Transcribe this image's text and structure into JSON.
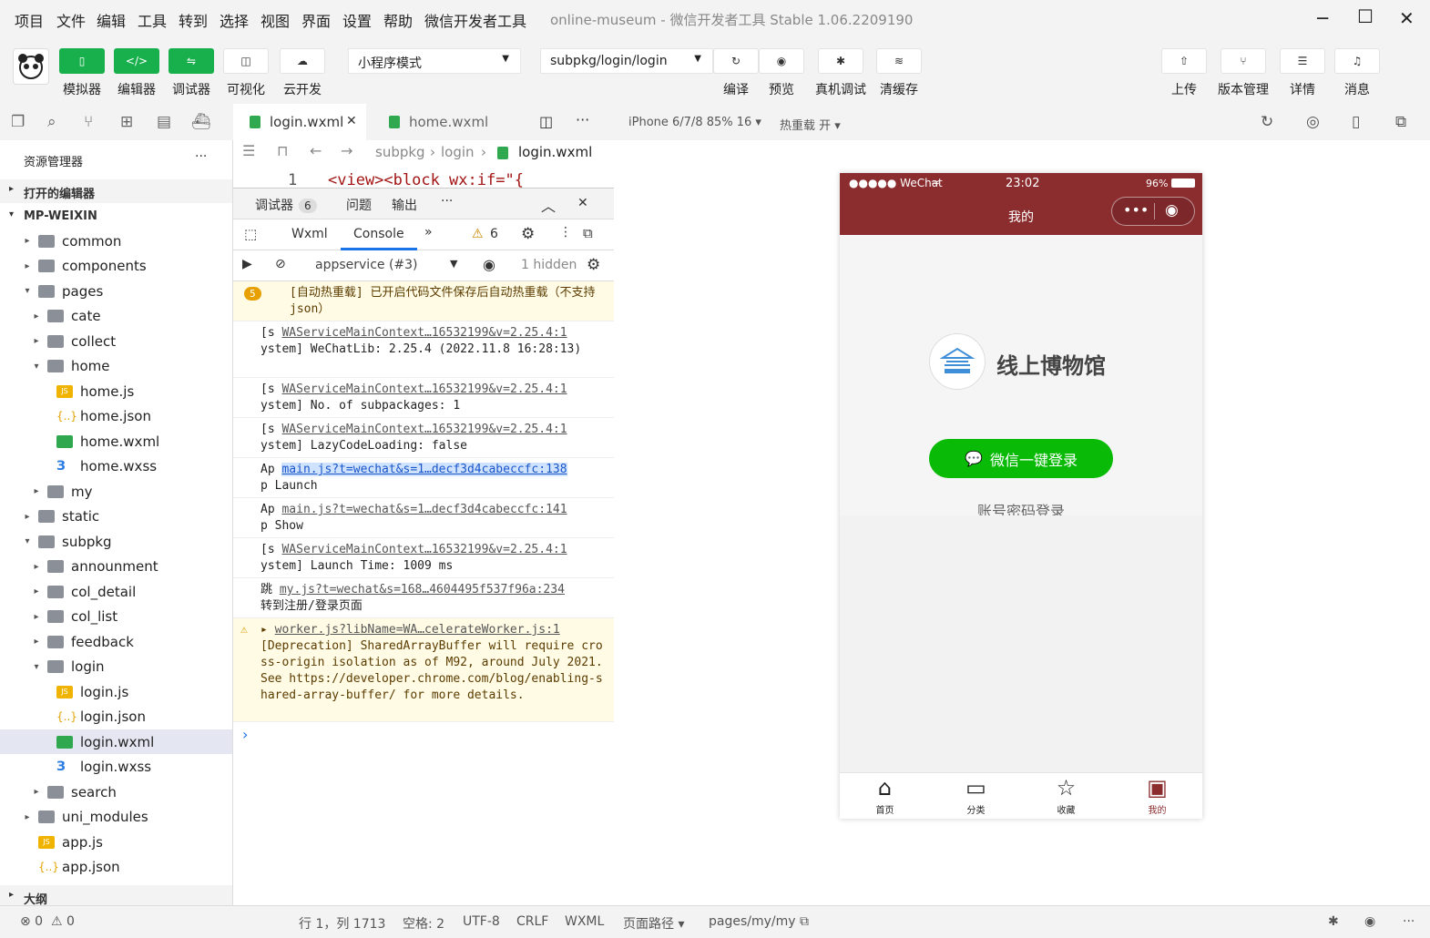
{
  "menu": [
    "项目",
    "文件",
    "编辑",
    "工具",
    "转到",
    "选择",
    "视图",
    "界面",
    "设置",
    "帮助",
    "微信开发者工具"
  ],
  "window_title": {
    "project": "online-museum",
    "separator": "-",
    "app": "微信开发者工具 Stable 1.06.2209190"
  },
  "toolbar": {
    "buttons_left": [
      "模拟器",
      "编辑器",
      "调试器",
      "可视化",
      "云开发"
    ],
    "mode_select": "小程序模式",
    "page_select": "subpkg/login/login",
    "buttons_mid": [
      "编译",
      "预览",
      "真机调试",
      "清缓存"
    ],
    "buttons_right": [
      "上传",
      "版本管理",
      "详情",
      "消息"
    ]
  },
  "explorer": {
    "title": "资源管理器",
    "more": "···",
    "open_editors": "打开的编辑器",
    "root": "MP-WEIXIN",
    "items": [
      {
        "label": "common",
        "type": "folder",
        "arrow": "▸",
        "depth": 1
      },
      {
        "label": "components",
        "type": "folder",
        "arrow": "▸",
        "depth": 1
      },
      {
        "label": "pages",
        "type": "folder",
        "arrow": "▾",
        "depth": 1
      },
      {
        "label": "cate",
        "type": "folder",
        "arrow": "▸",
        "depth": 2
      },
      {
        "label": "collect",
        "type": "folder",
        "arrow": "▸",
        "depth": 2
      },
      {
        "label": "home",
        "type": "folder",
        "arrow": "▾",
        "depth": 2
      },
      {
        "label": "home.js",
        "type": "js",
        "arrow": "",
        "depth": 3
      },
      {
        "label": "home.json",
        "type": "json",
        "arrow": "",
        "depth": 3
      },
      {
        "label": "home.wxml",
        "type": "wxml",
        "arrow": "",
        "depth": 3
      },
      {
        "label": "home.wxss",
        "type": "wxss",
        "arrow": "",
        "depth": 3
      },
      {
        "label": "my",
        "type": "folder",
        "arrow": "▸",
        "depth": 2
      },
      {
        "label": "static",
        "type": "folder",
        "arrow": "▸",
        "depth": 1
      },
      {
        "label": "subpkg",
        "type": "folder",
        "arrow": "▾",
        "depth": 1
      },
      {
        "label": "announment",
        "type": "folder",
        "arrow": "▸",
        "depth": 2
      },
      {
        "label": "col_detail",
        "type": "folder",
        "arrow": "▸",
        "depth": 2
      },
      {
        "label": "col_list",
        "type": "folder",
        "arrow": "▸",
        "depth": 2
      },
      {
        "label": "feedback",
        "type": "folder",
        "arrow": "▸",
        "depth": 2
      },
      {
        "label": "login",
        "type": "folder",
        "arrow": "▾",
        "depth": 2
      },
      {
        "label": "login.js",
        "type": "js",
        "arrow": "",
        "depth": 3
      },
      {
        "label": "login.json",
        "type": "json",
        "arrow": "",
        "depth": 3
      },
      {
        "label": "login.wxml",
        "type": "wxml",
        "arrow": "",
        "depth": 3,
        "active": true
      },
      {
        "label": "login.wxss",
        "type": "wxss",
        "arrow": "",
        "depth": 3
      },
      {
        "label": "search",
        "type": "folder",
        "arrow": "▸",
        "depth": 2
      },
      {
        "label": "uni_modules",
        "type": "folder",
        "arrow": "▸",
        "depth": 1
      },
      {
        "label": "app.js",
        "type": "js",
        "arrow": "",
        "depth": 1
      },
      {
        "label": "app.json",
        "type": "json",
        "arrow": "",
        "depth": 1
      }
    ],
    "outline": "大纲"
  },
  "editor": {
    "tabs": [
      "login.wxml",
      "home.wxml"
    ],
    "breadcrumb": [
      "subpkg",
      "login",
      "login.wxml"
    ],
    "code_line_no": "1",
    "code_line": "<view><block wx:if=\"{"
  },
  "devtools": {
    "tabs": [
      "调试器",
      "问题",
      "输出",
      "···"
    ],
    "debugger_badge": "6",
    "subtabs": [
      "Wxml",
      "Console",
      "»"
    ],
    "warn_count": "6",
    "context": "appservice (#3)",
    "hidden": "1 hidden",
    "logs": [
      {
        "kind": "warn",
        "badge": "5",
        "text": "[自动热重载] 已开启代码文件保存后自动热重载（不支持 json）"
      },
      {
        "kind": "info",
        "prefix": "[s",
        "link": "WAServiceMainContext…16532199&v=2.25.4:1",
        "text": "ystem] WeChatLib: 2.25.4 (2022.11.8 16:28:13)"
      },
      {
        "kind": "info",
        "prefix": "[s",
        "link": "WAServiceMainContext…16532199&v=2.25.4:1",
        "text": "ystem] No. of subpackages: 1"
      },
      {
        "kind": "info",
        "prefix": "[s",
        "link": "WAServiceMainContext…16532199&v=2.25.4:1",
        "text": "ystem] LazyCodeLoading: false"
      },
      {
        "kind": "info",
        "prefix": "Ap",
        "link": "main.js?t=wechat&s=1…decf3d4cabeccfc:138",
        "text": "p Launch",
        "hl": true
      },
      {
        "kind": "info",
        "prefix": "Ap",
        "link": "main.js?t=wechat&s=1…decf3d4cabeccfc:141",
        "text": "p Show"
      },
      {
        "kind": "info",
        "prefix": "[s",
        "link": "WAServiceMainContext…16532199&v=2.25.4:1",
        "text": "ystem] Launch Time: 1009 ms"
      },
      {
        "kind": "info",
        "prefix": "跳",
        "link": "my.js?t=wechat&s=168…4604495f537f96a:234",
        "text": "转到注册/登录页面"
      },
      {
        "kind": "warnbox",
        "prefix": "▸",
        "link": "worker.js?libName=WA…celerateWorker.js:1",
        "text": "[Deprecation] SharedArrayBuffer will require cross-origin isolation as of M92, around July 2021. See https://developer.chrome.com/blog/enabling-shared-array-buffer/ for more details."
      }
    ],
    "prompt": "›"
  },
  "simulator": {
    "device": "iPhone 6/7/8 85% 16 ▾",
    "hot_reload": "热重载 开 ▾",
    "status_left": "●●●●● WeChat",
    "status_time": "23:02",
    "status_battery": "96%",
    "nav_title": "我的",
    "brand_text": "线上博物馆",
    "login_button": "微信一键登录",
    "password_login": "账号密码登录",
    "tabbar": [
      {
        "label": "首页",
        "icon": "home-icon",
        "active": false
      },
      {
        "label": "分类",
        "icon": "folder-icon",
        "active": false
      },
      {
        "label": "收藏",
        "icon": "star-icon",
        "active": false
      },
      {
        "label": "我的",
        "icon": "profile-icon",
        "active": true
      }
    ],
    "accent_color": "#8b2d2f",
    "button_color": "#09bb07"
  },
  "statusbar": {
    "errors": "⊗ 0",
    "warnings": "⚠ 0",
    "position": "行 1，列 1713",
    "spaces": "空格: 2",
    "encoding": "UTF-8",
    "eol": "CRLF",
    "lang": "WXML",
    "page_path_label": "页面路径 ▾",
    "page_path": "pages/my/my"
  }
}
